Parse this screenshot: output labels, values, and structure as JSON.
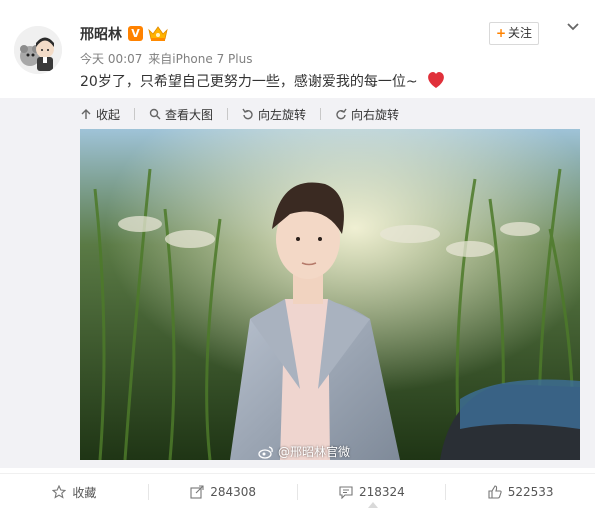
{
  "header": {
    "username": "邢昭林",
    "verified_badge": "V",
    "timestamp": "今天 00:07",
    "source_prefix": "来自",
    "source": "iPhone 7 Plus",
    "follow_label": "关注",
    "menu_icon": "chevron-down-icon"
  },
  "post": {
    "text": "20岁了，只希望自己更努力一些，感谢爱我的每一位~",
    "emoji": "heart-icon"
  },
  "media_toolbar": {
    "collapse": "收起",
    "view_large": "查看大图",
    "rotate_left": "向左旋转",
    "rotate_right": "向右旋转"
  },
  "photo": {
    "watermark": "@邢昭林官微"
  },
  "footer": {
    "favorite_label": "收藏",
    "repost_count": "284308",
    "comment_count": "218324",
    "like_count": "522533"
  },
  "colors": {
    "accent_orange": "#ff8200",
    "heart_red": "#e0303a",
    "text_gray": "#808080"
  }
}
